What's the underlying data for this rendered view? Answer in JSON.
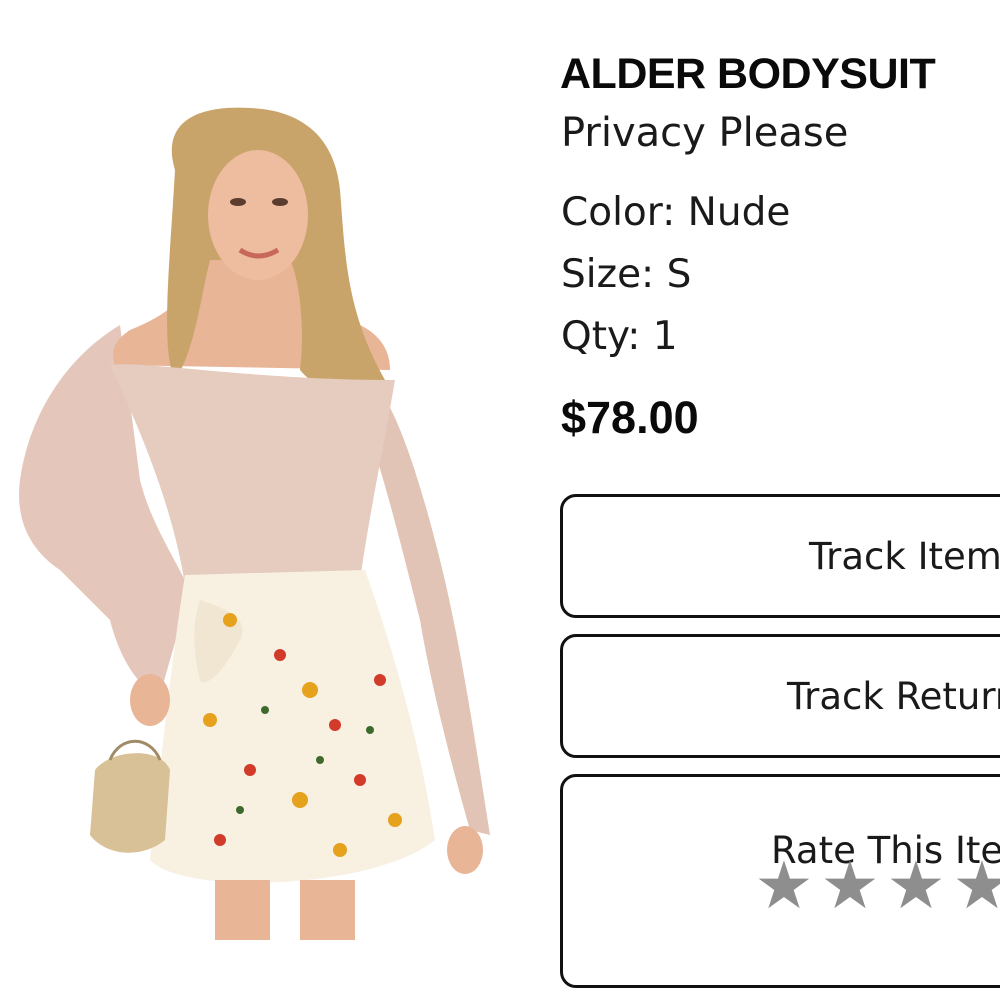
{
  "product": {
    "title": "ALDER BODYSUIT",
    "brand": "Privacy Please",
    "color": "Color: Nude",
    "size": "Size: S",
    "qty": "Qty: 1",
    "price": "$78.00",
    "image_alt": "Model wearing nude off-shoulder bodysuit with floral skirt"
  },
  "actions": {
    "track_item": "Track Item",
    "track_return": "Track Return",
    "rate_item": "Rate This Item",
    "rating_max": 5,
    "rating_value": 0
  },
  "colors": {
    "text": "#111111",
    "border": "#111111",
    "star_empty": "#8e8e8e",
    "bodysuit": "#e6cbbf",
    "skirt": "#f8f1e2"
  }
}
